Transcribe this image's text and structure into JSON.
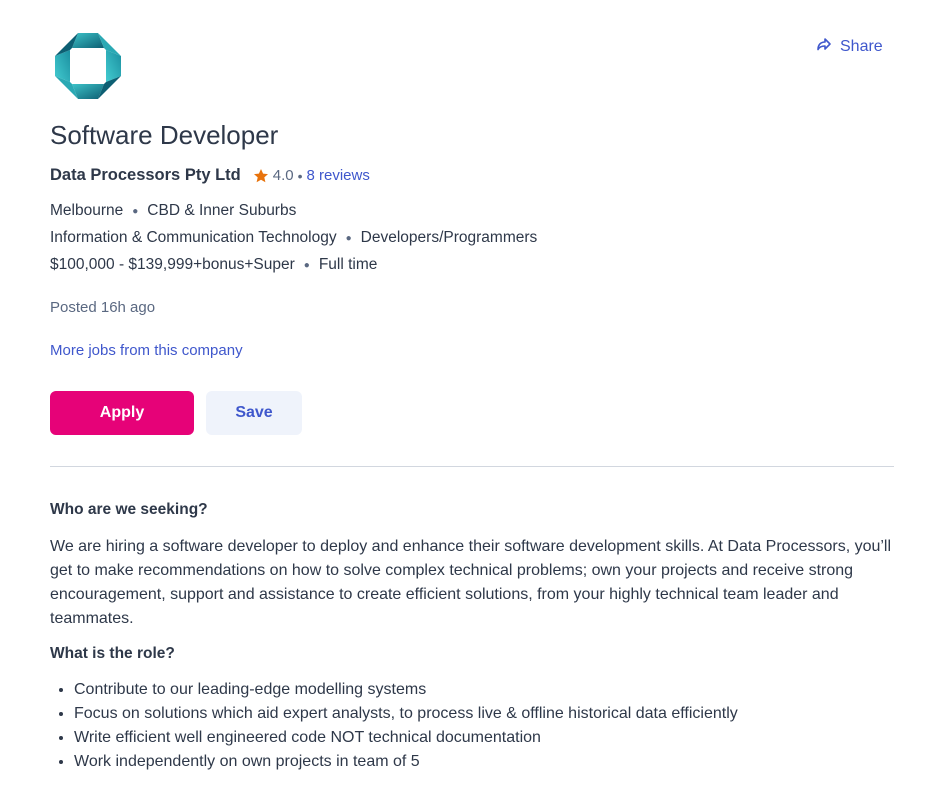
{
  "header": {
    "logo_icon": "company-logo-icon",
    "share_label": "Share",
    "share_icon": "share-arrow-icon"
  },
  "job": {
    "title": "Software Developer",
    "company": "Data Processors Pty Ltd",
    "rating": "4.0",
    "rating_separator": "•",
    "reviews_label": "8 reviews",
    "location": "Melbourne",
    "area": "CBD & Inner Suburbs",
    "classification": "Information & Communication Technology",
    "subclassification": "Developers/Programmers",
    "salary": "$100,000 - $139,999+bonus+Super",
    "work_type": "Full time",
    "posted": "Posted 16h ago",
    "more_jobs_label": "More jobs from this company"
  },
  "actions": {
    "apply_label": "Apply",
    "save_label": "Save"
  },
  "description": {
    "heading_seeking": "Who are we seeking?",
    "seeking_text": "We are hiring a software developer to deploy and enhance their software development skills. At Data Processors, you’ll get to make recommendations on how to solve complex technical problems; own your projects and receive strong encouragement, support and assistance to create efficient solutions, from your highly technical team leader and teammates.",
    "heading_role": "What is the role?",
    "role_items": [
      "Contribute to our leading-edge modelling systems",
      "Focus on solutions which aid expert analysts, to process live & offline historical data efficiently",
      "Write efficient well engineered code NOT technical documentation",
      "Work independently on own projects in team of 5"
    ]
  },
  "colors": {
    "brand_pink": "#e60278",
    "link_blue": "#3f57cc",
    "star_orange": "#e8730c",
    "logo_teal_dark": "#0d5f73",
    "logo_teal_light": "#3cc3c9"
  }
}
